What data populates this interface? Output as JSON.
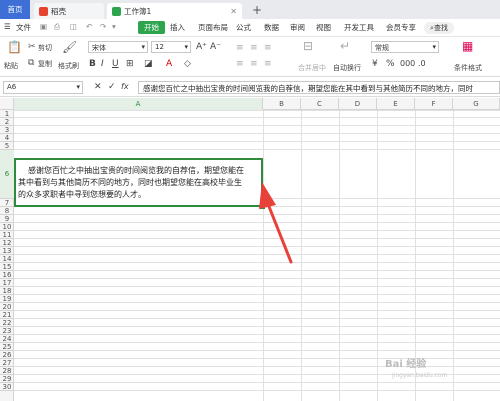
{
  "titlebar": {
    "home_tab": "首页",
    "doc_tab": "稻壳",
    "active_tab": "工作簿1",
    "add_tab": "+"
  },
  "menubar": {
    "file": "文件",
    "start": "开始",
    "items": [
      "插入",
      "页面布局",
      "公式",
      "数据",
      "审阅",
      "视图",
      "开发工具",
      "会员专享"
    ],
    "search": "查找"
  },
  "ribbon": {
    "paste": "粘贴",
    "cut": "剪切",
    "copy": "复制",
    "format_painter": "格式刷",
    "font_name": "宋体",
    "font_size": "12",
    "merge_center": "合并居中",
    "wrap_text": "自动换行",
    "number_format": "常规",
    "conditional_format": "条件格式"
  },
  "formula_bar": {
    "cell_ref": "A6",
    "fx": "fx",
    "value": "感谢您百忙之中抽出宝贵的时间阅览我的自荐信，期望您能在其中看到与其他简历不同的地方，同时"
  },
  "columns": [
    "A",
    "B",
    "C",
    "D",
    "E",
    "F",
    "G"
  ],
  "rows": [
    "1",
    "2",
    "3",
    "4",
    "5",
    "6",
    "7",
    "8",
    "9",
    "10",
    "11",
    "12",
    "13",
    "14",
    "15",
    "16",
    "17",
    "18",
    "19",
    "20",
    "21",
    "22",
    "23",
    "24",
    "25",
    "26",
    "27",
    "28",
    "29",
    "30"
  ],
  "cell_a6": {
    "line1": "感谢您百忙之中抽出宝贵的时间阅览我的自荐信，期望您能在",
    "line2": "其中看到与其他简历不同的地方，同时也期望您能在高校毕业生",
    "line3": "的众多求职者中寻到您想要的人才。"
  },
  "accent_color": "#2e8b3d",
  "arrow_color": "#e8413a"
}
